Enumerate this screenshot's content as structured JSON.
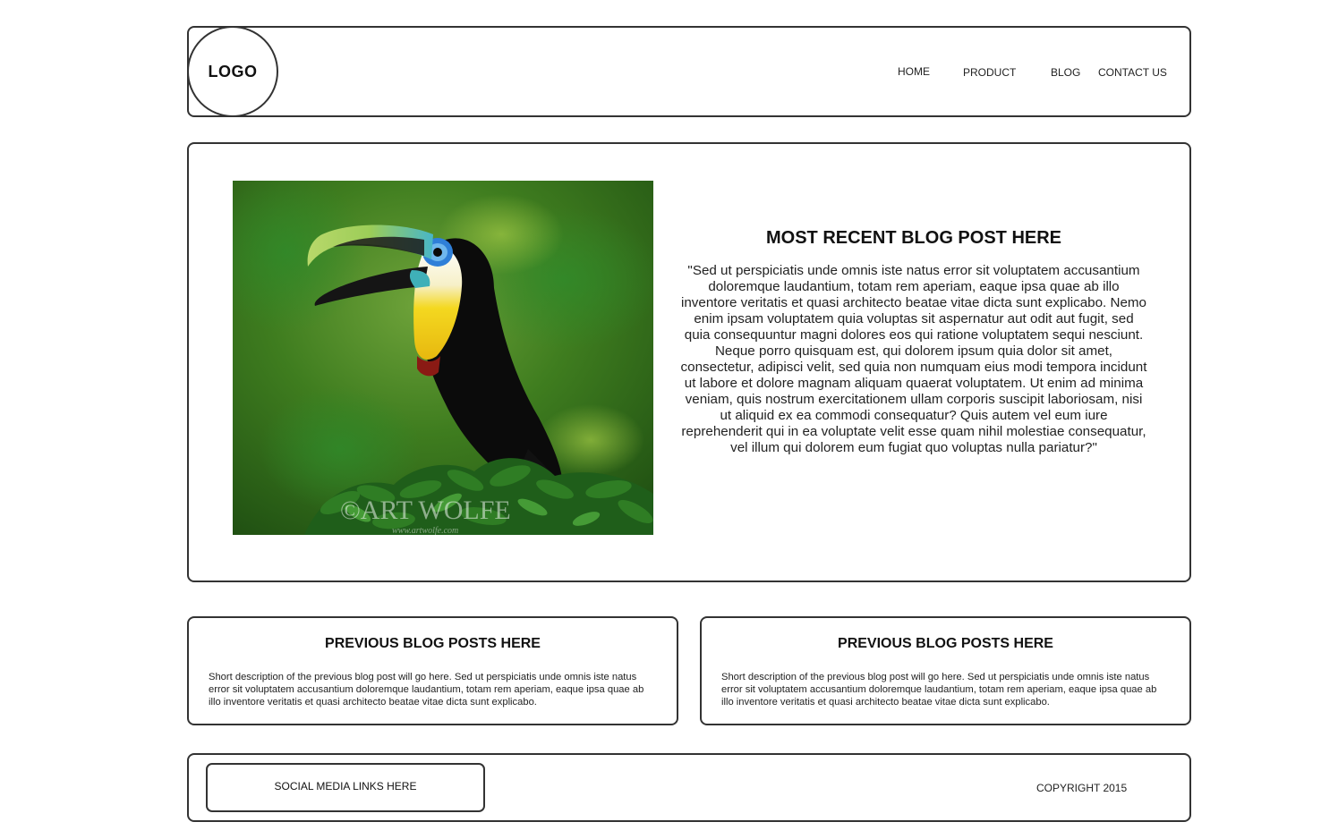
{
  "header": {
    "logo": "LOGO",
    "nav": {
      "home": "HOME",
      "product": "PRODUCT",
      "blog": "BLOG",
      "contact": "CONTACT US"
    }
  },
  "hero": {
    "title": "MOST RECENT BLOG POST HERE",
    "text": "\"Sed ut perspiciatis unde omnis iste natus error sit voluptatem accusantium doloremque laudantium, totam rem aperiam, eaque ipsa quae ab illo inventore veritatis et quasi architecto beatae vitae dicta sunt explicabo. Nemo enim ipsam voluptatem quia voluptas sit aspernatur aut odit aut fugit, sed quia consequuntur magni dolores eos qui ratione voluptatem sequi nesciunt. Neque porro quisquam est, qui dolorem ipsum quia dolor sit amet, consectetur, adipisci velit, sed quia non numquam eius modi tempora incidunt ut labore et dolore magnam aliquam quaerat voluptatem. Ut enim ad minima veniam, quis nostrum exercitationem ullam corporis suscipit laboriosam, nisi ut aliquid ex ea commodi consequatur? Quis autem vel eum iure reprehenderit qui in ea voluptate velit esse quam nihil molestiae consequatur, vel illum qui dolorem eum fugiat quo voluptas nulla pariatur?\"",
    "image_watermark": "©ART WOLFE",
    "image_watermark_url": "www.artwolfe.com"
  },
  "previous_posts": [
    {
      "title": "PREVIOUS BLOG POSTS HERE",
      "text": "Short description of the previous blog post will go here. Sed ut perspiciatis unde omnis iste natus error sit voluptatem accusantium doloremque laudantium, totam rem aperiam, eaque ipsa quae ab illo inventore veritatis et quasi architecto beatae vitae dicta sunt explicabo."
    },
    {
      "title": "PREVIOUS BLOG POSTS HERE",
      "text": "Short description of the previous blog post will go here. Sed ut perspiciatis unde omnis iste natus error sit voluptatem accusantium doloremque laudantium, totam rem aperiam, eaque ipsa quae ab illo inventore veritatis et quasi architecto beatae vitae dicta sunt explicabo."
    }
  ],
  "footer": {
    "social": "SOCIAL MEDIA LINKS HERE",
    "copyright": "COPYRIGHT 2015"
  }
}
